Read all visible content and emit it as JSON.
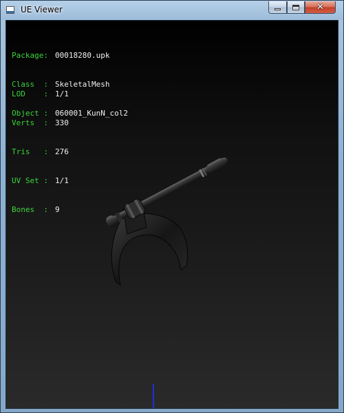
{
  "window": {
    "title": "UE Viewer",
    "controls": {
      "minimize": "minimize",
      "maximize": "maximize",
      "close": "✕"
    }
  },
  "mesh_info": {
    "package_label": "Package:",
    "package": "00018280.upk",
    "class_label": "Class  :",
    "class": "SkeletalMesh",
    "object_label": "Object :",
    "object": "060001_KunN_col2",
    "lod_label": "LOD    :",
    "lod": "1/1",
    "verts_label": "Verts  :",
    "verts": "330",
    "tris_label": "Tris   :",
    "tris": "276",
    "uvset_label": "UV Set :",
    "uvset": "1/1",
    "bones_label": "Bones  :",
    "bones": "9"
  },
  "colors": {
    "label_green": "#3bd43b",
    "value_white": "#f0f0f0",
    "axis_blue": "#2030d8"
  }
}
